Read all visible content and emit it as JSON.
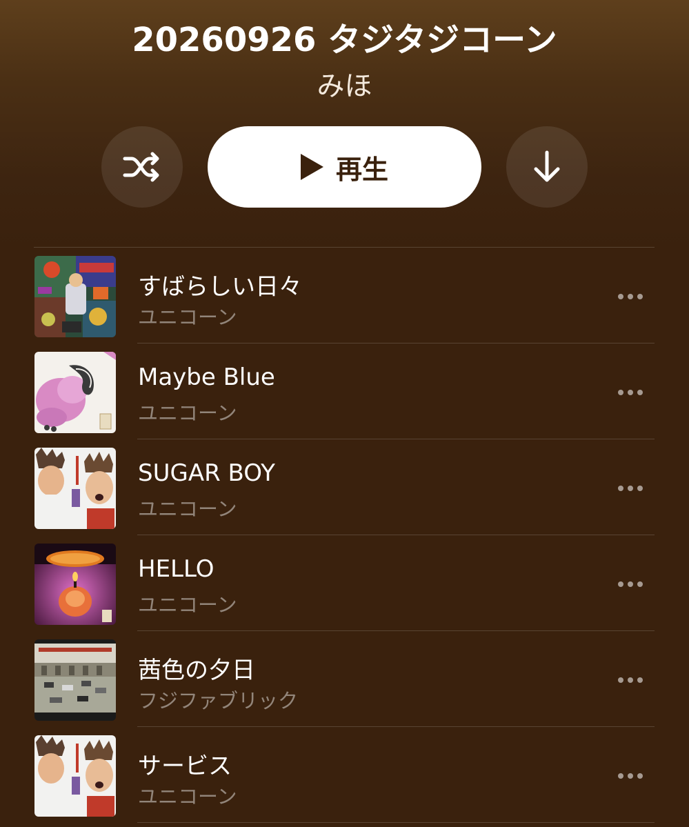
{
  "playlist": {
    "title": "20260926 タジタジコーン",
    "owner": "みほ"
  },
  "controls": {
    "shuffle_icon": "shuffle-icon",
    "play_label": "再生",
    "play_icon": "play-icon",
    "download_icon": "download-icon"
  },
  "colors": {
    "background": "#3a210d",
    "header_gradient_top": "#5e3f1c",
    "play_button_bg": "#ffffff",
    "secondary_text": "rgba(255,255,255,0.45)"
  },
  "tracks": [
    {
      "title": "すばらしい日々",
      "artist": "ユニコーン",
      "artwork": "album-art-spark"
    },
    {
      "title": "Maybe Blue",
      "artist": "ユニコーン",
      "artwork": "album-art-flower"
    },
    {
      "title": "SUGAR BOY",
      "artist": "ユニコーン",
      "artwork": "album-art-panic-attack"
    },
    {
      "title": "HELLO",
      "artist": "ユニコーン",
      "artwork": "album-art-candle"
    },
    {
      "title": "茜色の夕日",
      "artist": "フジファブリック",
      "artwork": "album-art-street"
    },
    {
      "title": "サービス",
      "artist": "ユニコーン",
      "artwork": "album-art-panic-attack"
    }
  ]
}
